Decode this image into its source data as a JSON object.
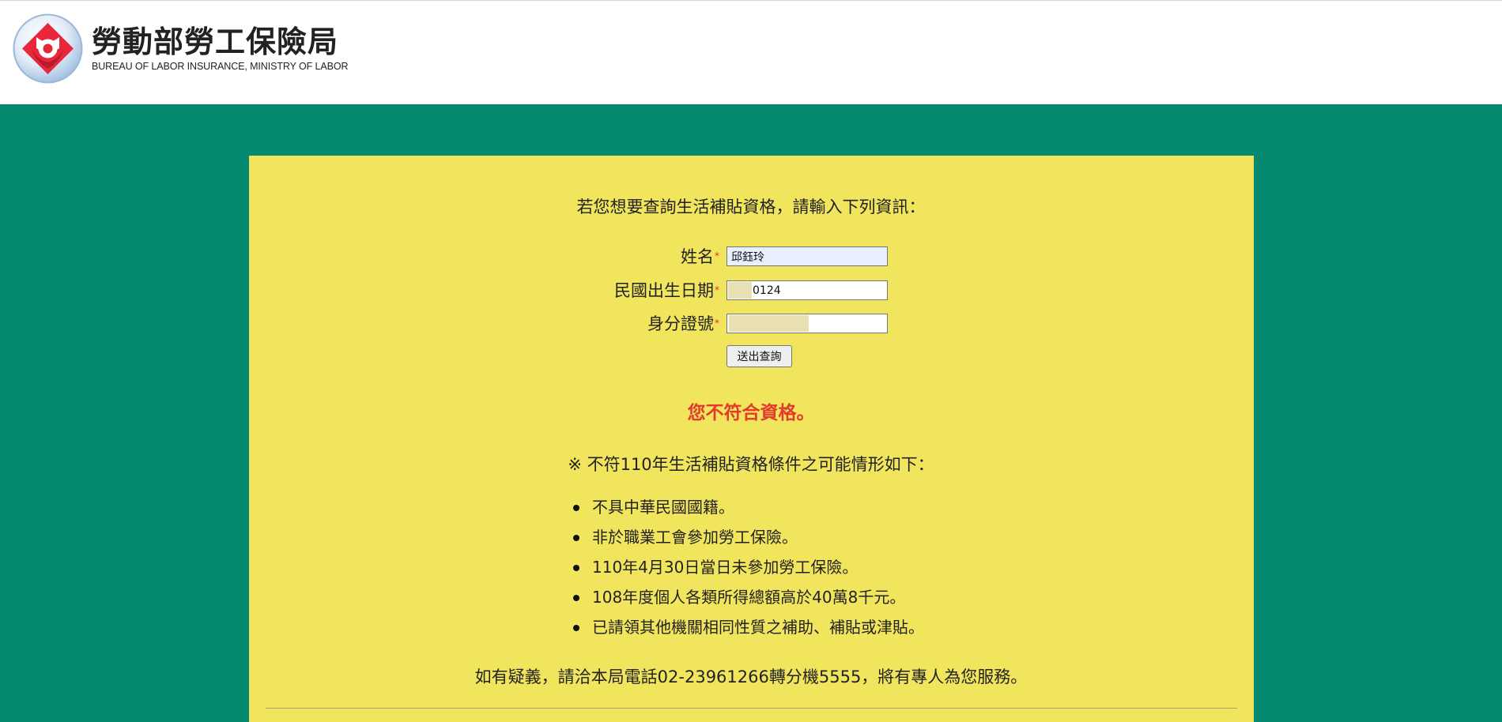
{
  "header": {
    "title": "勞動部勞工保險局",
    "subtitle": "BUREAU OF LABOR INSURANCE, MINISTRY OF LABOR",
    "logo_icon": "bli-logo-icon",
    "logo_colors": {
      "outer": "#9bbbe0",
      "diamond": "#e8283a"
    }
  },
  "colors": {
    "page_background": "#058970",
    "panel_background": "#f2e55e",
    "result_text": "#e23a2c",
    "required_star": "#e0302a"
  },
  "form": {
    "intro": "若您想要查詢生活補貼資格，請輸入下列資訊：",
    "required_mark": "*",
    "name_label": "姓名",
    "name_value": "邱鈺玲",
    "birthdate_label": "民國出生日期",
    "birthdate_value": "0124",
    "id_label": "身分證號",
    "id_value": "",
    "submit_label": "送出查詢"
  },
  "result": {
    "message": "您不符合資格。",
    "conditions_title": "※ 不符110年生活補貼資格條件之可能情形如下：",
    "conditions": [
      "不具中華民國國籍。",
      "非於職業工會參加勞工保險。",
      "110年4月30日當日未參加勞工保險。",
      "108年度個人各類所得總額高於40萬8千元。",
      "已請領其他機關相同性質之補助、補貼或津貼。"
    ],
    "contact": "如有疑義，請洽本局電話02-23961266轉分機5555，將有專人為您服務。"
  }
}
